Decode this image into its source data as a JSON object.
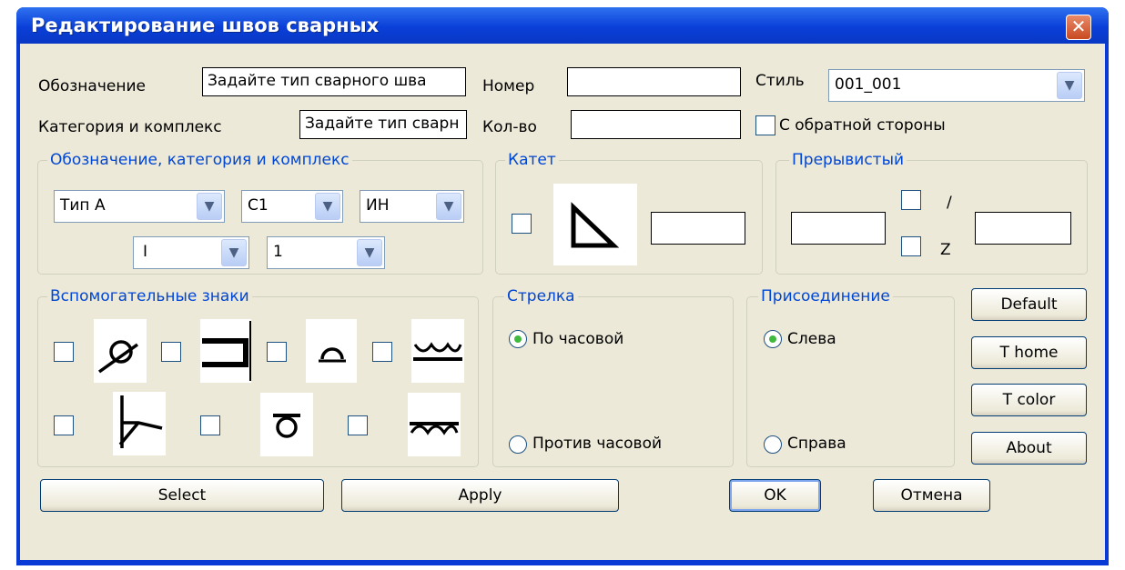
{
  "window": {
    "title": "Редактирование швов сварных",
    "close_glyph": "✕"
  },
  "row1": {
    "designation_label": "Обозначение",
    "designation_value": "Задайте тип сварного шва",
    "number_label": "Номер",
    "number_value": "",
    "style_label": "Стиль",
    "style_value": "001_001"
  },
  "row2": {
    "category_label": "Категория и комплекс",
    "category_value": "Задайте тип сварн",
    "count_label": "Кол-во",
    "count_value": "",
    "reverse_label": "С обратной стороны"
  },
  "group_designation": {
    "title": "Обозначение, категория и комплекс",
    "type_value": "Тип А",
    "c_value": "С1",
    "in_value": "ИН",
    "roman_value": "I",
    "num_value": "1"
  },
  "group_leg": {
    "title": "Катет",
    "value": ""
  },
  "group_intermittent": {
    "title": "Прерывистый",
    "slash_label": "/",
    "z_label": "Z",
    "left_value": "",
    "right_value": ""
  },
  "group_aux": {
    "title": "Вспомогательные знаки"
  },
  "group_arrow": {
    "title": "Стрелка",
    "clockwise": "По часовой",
    "counterclockwise": "Против часовой"
  },
  "group_join": {
    "title": "Присоединение",
    "left": "Слева",
    "right": "Справа"
  },
  "side_buttons": {
    "default": "Default",
    "t_home": "T home",
    "t_color": "T color",
    "about": "About"
  },
  "bottom_buttons": {
    "select": "Select",
    "apply": "Apply",
    "ok": "OK",
    "cancel": "Отмена"
  },
  "icons": {
    "dropdown_arrow": "chevron-down-icon",
    "accent": "#0046d5",
    "title_bar": "#0a3ad6"
  }
}
